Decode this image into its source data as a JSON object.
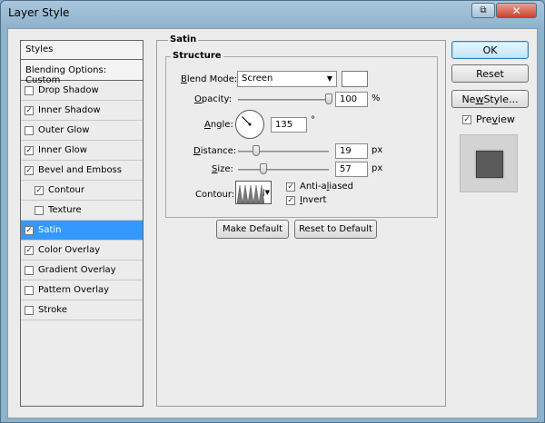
{
  "window": {
    "title": "Layer Style",
    "restore_glyph": "⧉",
    "close_glyph": "✕"
  },
  "styles_list": {
    "header": "Styles",
    "blending_options": "Blending Options: Custom",
    "items": [
      {
        "label": "Drop Shadow",
        "checked": false,
        "selected": false,
        "sub": false
      },
      {
        "label": "Inner Shadow",
        "checked": true,
        "selected": false,
        "sub": false
      },
      {
        "label": "Outer Glow",
        "checked": false,
        "selected": false,
        "sub": false
      },
      {
        "label": "Inner Glow",
        "checked": true,
        "selected": false,
        "sub": false
      },
      {
        "label": "Bevel and Emboss",
        "checked": true,
        "selected": false,
        "sub": false
      },
      {
        "label": "Contour",
        "checked": true,
        "selected": false,
        "sub": true
      },
      {
        "label": "Texture",
        "checked": false,
        "selected": false,
        "sub": true
      },
      {
        "label": "Satin",
        "checked": true,
        "selected": true,
        "sub": false
      },
      {
        "label": "Color Overlay",
        "checked": true,
        "selected": false,
        "sub": false
      },
      {
        "label": "Gradient Overlay",
        "checked": false,
        "selected": false,
        "sub": false
      },
      {
        "label": "Pattern Overlay",
        "checked": false,
        "selected": false,
        "sub": false
      },
      {
        "label": "Stroke",
        "checked": false,
        "selected": false,
        "sub": false
      }
    ]
  },
  "satin": {
    "group_title": "Satin",
    "structure_title": "Structure",
    "blend_mode_label_pre": "B",
    "blend_mode_label_post": "lend Mode:",
    "blend_mode_value": "Screen",
    "blend_color": "#ffffff",
    "opacity_label_pre": "O",
    "opacity_label_post": "pacity:",
    "opacity_value": "100",
    "opacity_unit": "%",
    "opacity_level": 1.0,
    "angle_label_pre": "A",
    "angle_label_post": "ngle:",
    "angle_value": "135",
    "angle_unit": "°",
    "distance_label_pre": "D",
    "distance_label_post": "istance:",
    "distance_value": "19",
    "distance_unit": "px",
    "size_label_pre": "S",
    "size_label_post": "ize:",
    "size_value": "57",
    "size_unit": "px",
    "contour_label": "Contour:",
    "anti_aliased_pre": "Anti-a",
    "anti_aliased_u": "l",
    "anti_aliased_post": "iased",
    "anti_aliased_checked": true,
    "invert_pre": "",
    "invert_u": "I",
    "invert_post": "nvert",
    "invert_checked": true,
    "make_default": "Make Default",
    "reset_to_default": "Reset to Default"
  },
  "actions": {
    "ok": "OK",
    "reset": "Reset",
    "new_style_pre": "Ne",
    "new_style_u": "w",
    "new_style_post": " Style...",
    "preview_pre": "Pre",
    "preview_u": "v",
    "preview_post": "iew",
    "preview_checked": true
  },
  "colors": {
    "selection": "#3399ff",
    "default_button_border": "#3c7fb1",
    "preview_swatch": "#5a5a5a"
  }
}
